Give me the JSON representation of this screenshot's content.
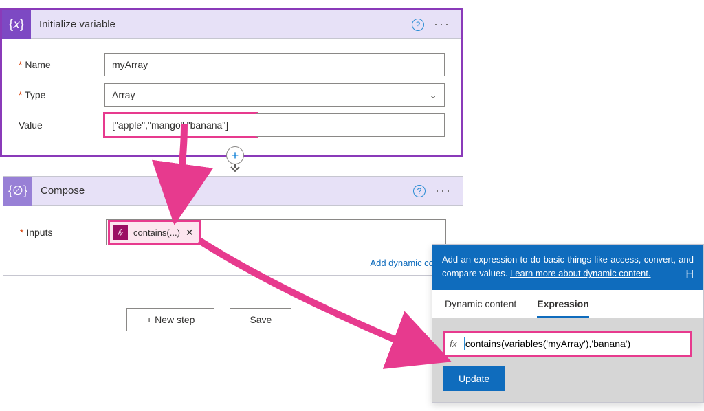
{
  "initVar": {
    "title": "Initialize variable",
    "nameLabel": "Name",
    "nameValue": "myArray",
    "typeLabel": "Type",
    "typeValue": "Array",
    "valueLabel": "Value",
    "valueValue": "[\"apple\",\"mango\",\"banana\"]"
  },
  "compose": {
    "title": "Compose",
    "inputsLabel": "Inputs",
    "tokenLabel": "contains(...)",
    "addDynamic": "Add dynamic conte"
  },
  "buttons": {
    "newStep": "+ New step",
    "save": "Save"
  },
  "flyout": {
    "headText": "Add an expression to do basic things like access, convert, and compare values. ",
    "headLink": "Learn more about dynamic content.",
    "tabDynamic": "Dynamic content",
    "tabExpression": "Expression",
    "fxLabel": "fx",
    "expression": "contains(variables('myArray'),'banana')",
    "tailLetter": "H",
    "updateLabel": "Update"
  }
}
